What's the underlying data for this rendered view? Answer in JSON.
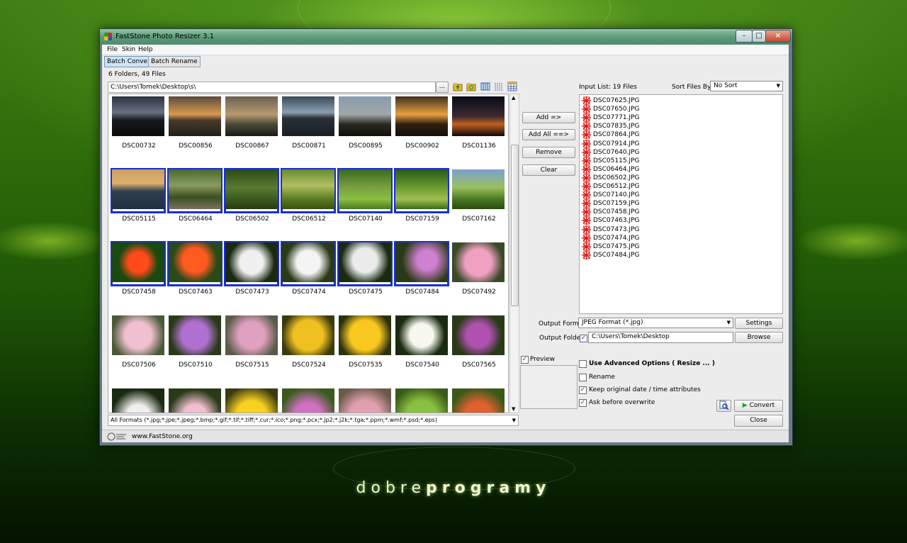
{
  "app": {
    "title": "FastStone Photo Resizer 3.1"
  },
  "menu": [
    "File",
    "Skin",
    "Help"
  ],
  "tabs": [
    {
      "label": "Batch Convert",
      "active": true
    },
    {
      "label": "Batch Rename",
      "active": false
    }
  ],
  "browser": {
    "folder_info": "6 Folders, 49 Files",
    "path": "C:\\Users\\Tomek\\Desktop\\s\\",
    "browse_label": "...",
    "filter": "All Formats (*.jpg;*.jpe;*.jpeg;*.bmp;*.gif;*.tif;*.tiff;*.cur;*.ico;*.png;*.pcx;*.jp2;*.j2k;*.tga;*.ppm;*.wmf;*.psd;*.eps)"
  },
  "thumbnails": [
    {
      "name": "DSC00732",
      "selected": false
    },
    {
      "name": "DSC00856",
      "selected": false
    },
    {
      "name": "DSC00867",
      "selected": false
    },
    {
      "name": "DSC00871",
      "selected": false
    },
    {
      "name": "DSC00895",
      "selected": false
    },
    {
      "name": "DSC00902",
      "selected": false
    },
    {
      "name": "DSC01136",
      "selected": false
    },
    {
      "name": "DSC05115",
      "selected": true
    },
    {
      "name": "DSC06464",
      "selected": true
    },
    {
      "name": "DSC06502",
      "selected": true
    },
    {
      "name": "DSC06512",
      "selected": true
    },
    {
      "name": "DSC07140",
      "selected": true
    },
    {
      "name": "DSC07159",
      "selected": true
    },
    {
      "name": "DSC07162",
      "selected": false
    },
    {
      "name": "DSC07458",
      "selected": true
    },
    {
      "name": "DSC07463",
      "selected": true
    },
    {
      "name": "DSC07473",
      "selected": true
    },
    {
      "name": "DSC07474",
      "selected": true
    },
    {
      "name": "DSC07475",
      "selected": true
    },
    {
      "name": "DSC07484",
      "selected": true
    },
    {
      "name": "DSC07492",
      "selected": false
    },
    {
      "name": "DSC07506",
      "selected": false
    },
    {
      "name": "DSC07510",
      "selected": false
    },
    {
      "name": "DSC07515",
      "selected": false
    },
    {
      "name": "DSC07524",
      "selected": false
    },
    {
      "name": "DSC07535",
      "selected": false
    },
    {
      "name": "DSC07540",
      "selected": false
    },
    {
      "name": "DSC07565",
      "selected": false
    },
    {
      "name": "",
      "selected": false
    },
    {
      "name": "",
      "selected": false
    },
    {
      "name": "",
      "selected": false
    },
    {
      "name": "",
      "selected": false
    },
    {
      "name": "",
      "selected": false
    },
    {
      "name": "",
      "selected": false
    },
    {
      "name": "",
      "selected": false
    }
  ],
  "actions": {
    "add": "Add =>",
    "add_all": "Add All ==>",
    "remove": "Remove",
    "clear": "Clear"
  },
  "input_list": {
    "label": "Input List:  19 Files",
    "sort_label": "Sort Files By:",
    "sort_value": "No Sort",
    "files": [
      "DSC07625.JPG",
      "DSC07650.JPG",
      "DSC07771.JPG",
      "DSC07835.JPG",
      "DSC07864.JPG",
      "DSC07914.JPG",
      "DSC07640.JPG",
      "DSC05115.JPG",
      "DSC06464.JPG",
      "DSC06502.JPG",
      "DSC06512.JPG",
      "DSC07140.JPG",
      "DSC07159.JPG",
      "DSC07458.JPG",
      "DSC07463.JPG",
      "DSC07473.JPG",
      "DSC07474.JPG",
      "DSC07475.JPG",
      "DSC07484.JPG"
    ]
  },
  "output": {
    "format_label": "Output Format:",
    "format_value": "JPEG Format (*.jpg)",
    "settings": "Settings",
    "folder_label": "Output Folder:",
    "folder_value": "C:\\Users\\Tomek\\Desktop",
    "browse": "Browse"
  },
  "options": {
    "preview": "Preview",
    "advanced": "Use Advanced Options ( Resize ... )",
    "rename": "Rename",
    "keep_attrs": "Keep original date / time attributes",
    "ask_overwrite": "Ask before overwrite",
    "convert": "Convert",
    "close": "Close",
    "states": {
      "preview": true,
      "advanced": false,
      "rename": false,
      "keep_attrs": true,
      "ask_overwrite": true,
      "folder": true
    }
  },
  "status": {
    "website": "www.FastStone.org"
  },
  "branding": {
    "part1": "dobre",
    "part2": "programy"
  }
}
